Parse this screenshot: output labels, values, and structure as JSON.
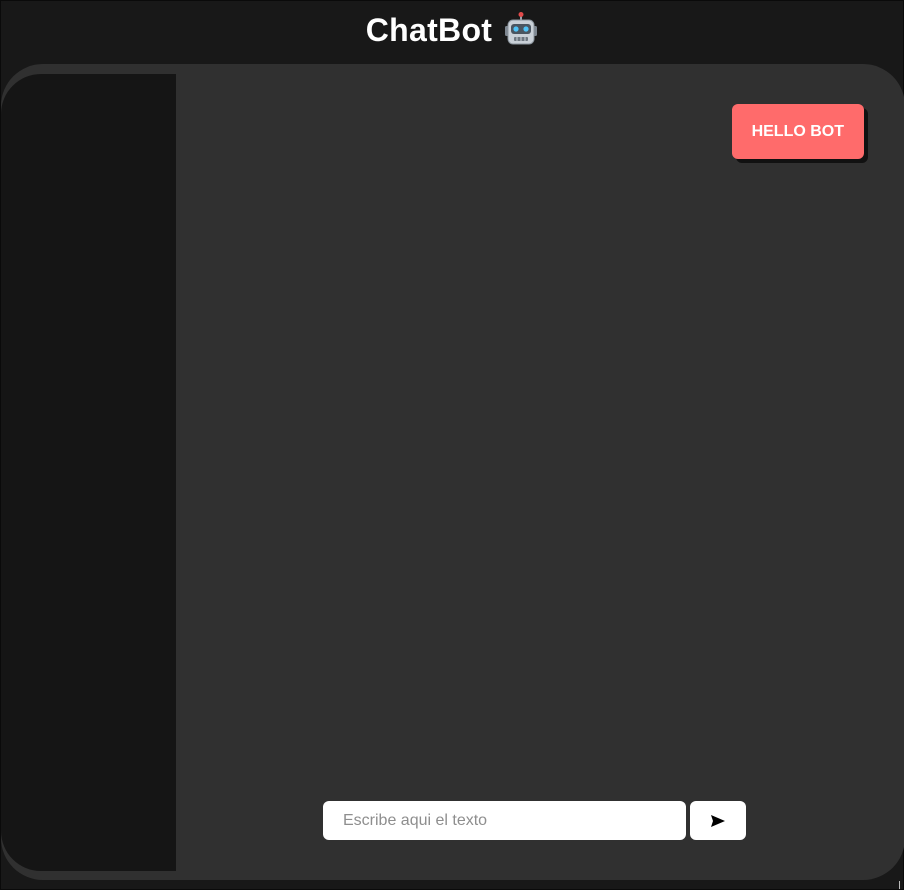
{
  "header": {
    "title": "ChatBot",
    "icon": "robot-icon"
  },
  "chat": {
    "messages": [
      {
        "sender": "user",
        "text": "HELLO BOT"
      }
    ]
  },
  "composer": {
    "placeholder": "Escribe aqui el texto",
    "value": "",
    "send_icon": "send-icon"
  },
  "colors": {
    "background": "#181818",
    "panel": "#303030",
    "sidebar": "#151515",
    "user_bubble": "#ff6b6b",
    "text_on_dark": "#ffffff"
  }
}
